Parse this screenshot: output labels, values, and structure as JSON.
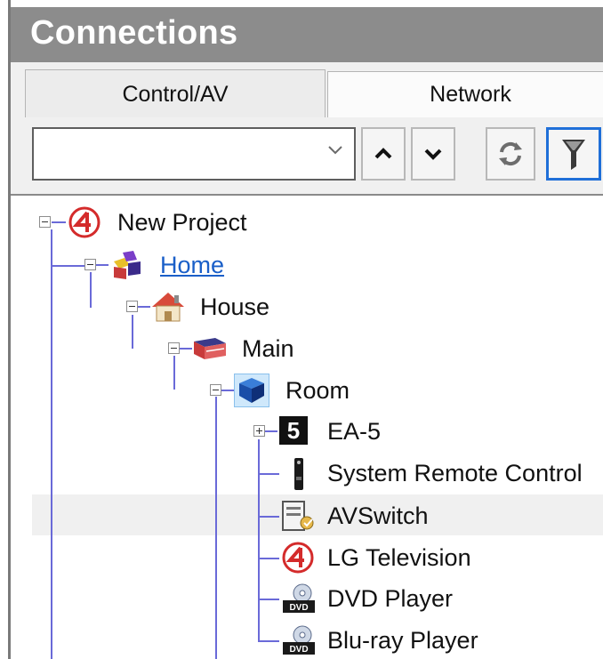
{
  "panel": {
    "title": "Connections"
  },
  "tabs": [
    {
      "label": "Control/AV",
      "active": true
    },
    {
      "label": "Network",
      "active": false
    }
  ],
  "toolbar": {
    "search": {
      "value": "",
      "placeholder": ""
    },
    "buttons": [
      "up-arrow",
      "down-arrow",
      "refresh",
      "filter"
    ]
  },
  "tree": {
    "project": {
      "label": "New Project"
    },
    "home": {
      "label": "Home"
    },
    "house": {
      "label": "House"
    },
    "main": {
      "label": "Main"
    },
    "room": {
      "label": "Room"
    },
    "devices": [
      {
        "label": "EA-5",
        "badge": "5"
      },
      {
        "label": "System Remote Control"
      },
      {
        "label": "AVSwitch"
      },
      {
        "label": "LG Television"
      },
      {
        "label": "DVD Player"
      },
      {
        "label": "Blu-ray Player"
      }
    ]
  },
  "colors": {
    "title_bar": "#8c8c8c",
    "tree_lines": "#6a6ad8",
    "link": "#1a5fc8",
    "control4_red": "#d42b2b",
    "filter_active_border": "#1f6fd8"
  }
}
